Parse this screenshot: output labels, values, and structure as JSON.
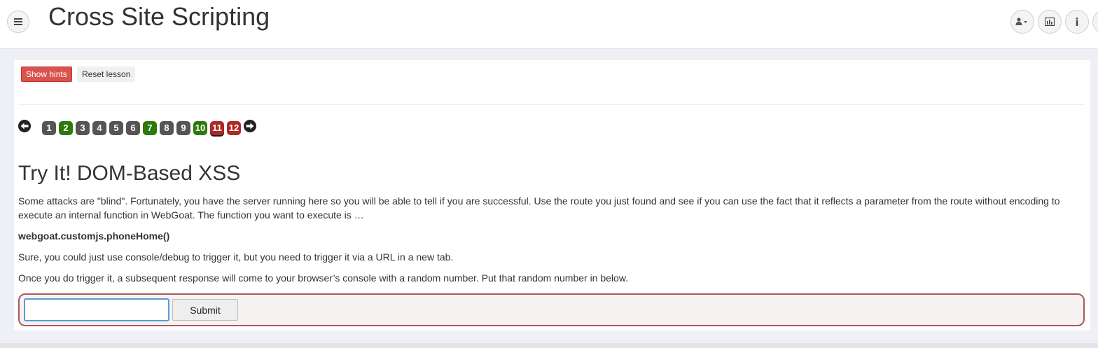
{
  "header": {
    "title": "Cross Site Scripting",
    "menu_icon": "hamburger-icon",
    "user_icon": "user-icon",
    "report_icon": "report-card-icon",
    "about_icon": "info-icon"
  },
  "toolbar": {
    "show_hints_label": "Show hints",
    "reset_lesson_label": "Reset lesson"
  },
  "pagination": {
    "prev_icon": "arrow-left-icon",
    "next_icon": "arrow-right-icon",
    "pages": [
      {
        "label": "1",
        "status": "unvisited"
      },
      {
        "label": "2",
        "status": "solved"
      },
      {
        "label": "3",
        "status": "unvisited"
      },
      {
        "label": "4",
        "status": "unvisited"
      },
      {
        "label": "5",
        "status": "unvisited"
      },
      {
        "label": "6",
        "status": "unvisited"
      },
      {
        "label": "7",
        "status": "solved"
      },
      {
        "label": "8",
        "status": "unvisited"
      },
      {
        "label": "9",
        "status": "unvisited"
      },
      {
        "label": "10",
        "status": "solved"
      },
      {
        "label": "11",
        "status": "current-unsolved"
      },
      {
        "label": "12",
        "status": "unsolved"
      }
    ],
    "colors": {
      "unvisited": "#555555",
      "solved": "#2b7a0b",
      "unsolved": "#ac2925"
    }
  },
  "lesson": {
    "title": "Try It! DOM-Based XSS",
    "paragraph_1": "Some attacks are \"blind\". Fortunately, you have the server running here so you will be able to tell if you are successful. Use the route you just found and see if you can use the fact that it reflects a parameter from the route without encoding to execute an internal function in WebGoat. The function you want to execute is …",
    "function_name": "webgoat.customjs.phoneHome()",
    "paragraph_2": "Sure, you could just use console/debug to trigger it, but you need to trigger it via a URL in a new tab.",
    "paragraph_3": "Once you do trigger it, a subsequent response will come to your browser’s console with a random number. Put that random number in below."
  },
  "form": {
    "answer_value": "",
    "submit_label": "Submit"
  }
}
